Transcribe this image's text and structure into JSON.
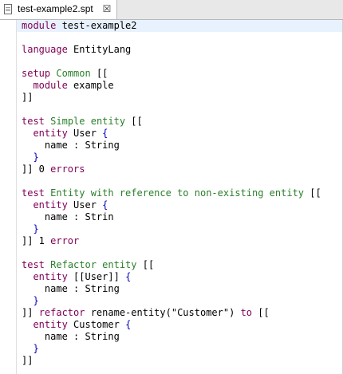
{
  "tab": {
    "title": "test-example2.spt",
    "close_glyph": "☒",
    "icon": "file-icon"
  },
  "colors": {
    "keyword": "#7f0055",
    "name": "#2a7f2a",
    "brace": "#0000c0",
    "current_line": "#e8f2fe"
  },
  "editor": {
    "lines": [
      [
        {
          "t": "module",
          "c": "kw"
        },
        {
          "t": " test-example2",
          "c": ""
        }
      ],
      [],
      [
        {
          "t": "language",
          "c": "kw"
        },
        {
          "t": " EntityLang",
          "c": ""
        }
      ],
      [],
      [
        {
          "t": "setup",
          "c": "kw"
        },
        {
          "t": " ",
          "c": ""
        },
        {
          "t": "Common",
          "c": "str-c"
        },
        {
          "t": " [[",
          "c": ""
        }
      ],
      [
        {
          "t": "  ",
          "c": ""
        },
        {
          "t": "module",
          "c": "kw"
        },
        {
          "t": " example",
          "c": ""
        }
      ],
      [
        {
          "t": "]]",
          "c": ""
        }
      ],
      [],
      [
        {
          "t": "test",
          "c": "kw"
        },
        {
          "t": " ",
          "c": ""
        },
        {
          "t": "Simple entity",
          "c": "str-c"
        },
        {
          "t": " [[",
          "c": ""
        }
      ],
      [
        {
          "t": "  ",
          "c": ""
        },
        {
          "t": "entity",
          "c": "kw"
        },
        {
          "t": " User ",
          "c": ""
        },
        {
          "t": "{",
          "c": "brace"
        }
      ],
      [
        {
          "t": "    name : String",
          "c": ""
        }
      ],
      [
        {
          "t": "  ",
          "c": ""
        },
        {
          "t": "}",
          "c": "brace"
        }
      ],
      [
        {
          "t": "]] 0 ",
          "c": ""
        },
        {
          "t": "errors",
          "c": "kw"
        }
      ],
      [],
      [
        {
          "t": "test",
          "c": "kw"
        },
        {
          "t": " ",
          "c": ""
        },
        {
          "t": "Entity with reference to non-existing entity",
          "c": "str-c"
        },
        {
          "t": " [[",
          "c": ""
        }
      ],
      [
        {
          "t": "  ",
          "c": ""
        },
        {
          "t": "entity",
          "c": "kw"
        },
        {
          "t": " User ",
          "c": ""
        },
        {
          "t": "{",
          "c": "brace"
        }
      ],
      [
        {
          "t": "    name : Strin",
          "c": ""
        }
      ],
      [
        {
          "t": "  ",
          "c": ""
        },
        {
          "t": "}",
          "c": "brace"
        }
      ],
      [
        {
          "t": "]] 1 ",
          "c": ""
        },
        {
          "t": "error",
          "c": "kw"
        }
      ],
      [],
      [
        {
          "t": "test",
          "c": "kw"
        },
        {
          "t": " ",
          "c": ""
        },
        {
          "t": "Refactor entity",
          "c": "str-c"
        },
        {
          "t": " [[",
          "c": ""
        }
      ],
      [
        {
          "t": "  ",
          "c": ""
        },
        {
          "t": "entity",
          "c": "kw"
        },
        {
          "t": " [[User]] ",
          "c": ""
        },
        {
          "t": "{",
          "c": "brace"
        }
      ],
      [
        {
          "t": "    name : String",
          "c": ""
        }
      ],
      [
        {
          "t": "  ",
          "c": ""
        },
        {
          "t": "}",
          "c": "brace"
        }
      ],
      [
        {
          "t": "]] ",
          "c": ""
        },
        {
          "t": "refactor",
          "c": "kw"
        },
        {
          "t": " rename-entity(\"Customer\") ",
          "c": ""
        },
        {
          "t": "to",
          "c": "kw"
        },
        {
          "t": " [[",
          "c": ""
        }
      ],
      [
        {
          "t": "  ",
          "c": ""
        },
        {
          "t": "entity",
          "c": "kw"
        },
        {
          "t": " Customer ",
          "c": ""
        },
        {
          "t": "{",
          "c": "brace"
        }
      ],
      [
        {
          "t": "    name : String",
          "c": ""
        }
      ],
      [
        {
          "t": "  ",
          "c": ""
        },
        {
          "t": "}",
          "c": "brace"
        }
      ],
      [
        {
          "t": "]]",
          "c": ""
        }
      ]
    ]
  }
}
